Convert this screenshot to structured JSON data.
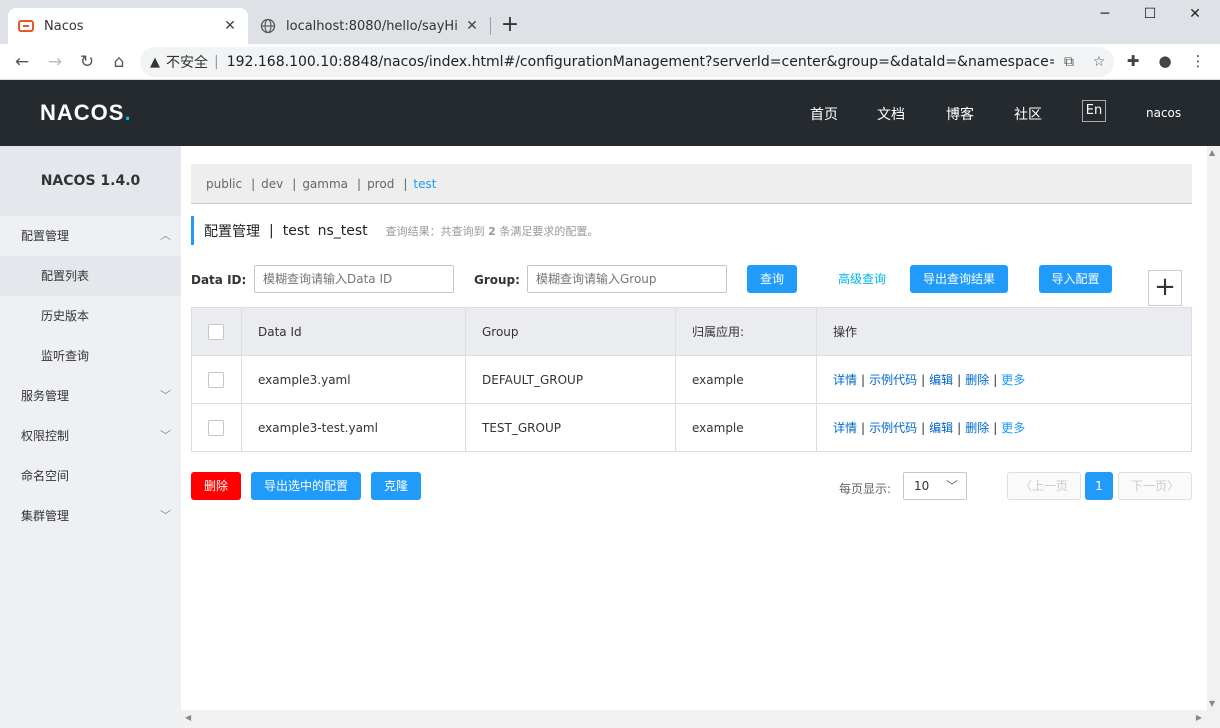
{
  "browser": {
    "tabs": [
      {
        "title": "Nacos",
        "active": true
      },
      {
        "title": "localhost:8080/hello/sayHi",
        "active": false
      }
    ],
    "insecure_label": "不安全",
    "url": "192.168.100.10:8848/nacos/index.html#/configurationManagement?serverId=center&group=&dataId=&namespace=..."
  },
  "header": {
    "logo": "NACOS",
    "logo_dot": ".",
    "nav": [
      "首页",
      "文档",
      "博客",
      "社区"
    ],
    "lang": "En",
    "user": "nacos"
  },
  "sidebar": {
    "title": "NACOS 1.4.0",
    "items": [
      {
        "label": "配置管理",
        "expanded": true
      },
      {
        "label": "服务管理"
      },
      {
        "label": "权限控制"
      },
      {
        "label": "命名空间"
      },
      {
        "label": "集群管理"
      }
    ],
    "subitems": [
      "配置列表",
      "历史版本",
      "监听查询"
    ]
  },
  "namespaces": [
    "public",
    "dev",
    "gamma",
    "prod",
    "test"
  ],
  "active_namespace": "test",
  "title": {
    "section": "配置管理",
    "pipe": "|",
    "namespace": "test",
    "namespace_id": "ns_test",
    "result_prefix": "查询结果：共查询到",
    "result_count": "2",
    "result_suffix": "条满足要求的配置。"
  },
  "search": {
    "dataid_label": "Data ID:",
    "dataid_placeholder": "模糊查询请输入Data ID",
    "group_label": "Group:",
    "group_placeholder": "模糊查询请输入Group",
    "query_btn": "查询",
    "advanced": "高级查询",
    "export_btn": "导出查询结果",
    "import_btn": "导入配置"
  },
  "table": {
    "headers": [
      "Data Id",
      "Group",
      "归属应用:",
      "操作"
    ],
    "rows": [
      {
        "data_id": "example3.yaml",
        "group": "DEFAULT_GROUP",
        "app": "example"
      },
      {
        "data_id": "example3-test.yaml",
        "group": "TEST_GROUP",
        "app": "example"
      }
    ],
    "ops": [
      "详情",
      "示例代码",
      "编辑",
      "删除",
      "更多"
    ]
  },
  "bottom": {
    "delete_btn": "删除",
    "export_selected": "导出选中的配置",
    "clone_btn": "克隆",
    "page_size_label": "每页显示:",
    "page_size": "10",
    "prev": "上一页",
    "current_page": "1",
    "next": "下一页"
  },
  "colors": {
    "primary": "#209bfa",
    "danger": "#ff0000",
    "header_bg": "#252a2f",
    "sidebar_bg": "#eef0f3"
  }
}
